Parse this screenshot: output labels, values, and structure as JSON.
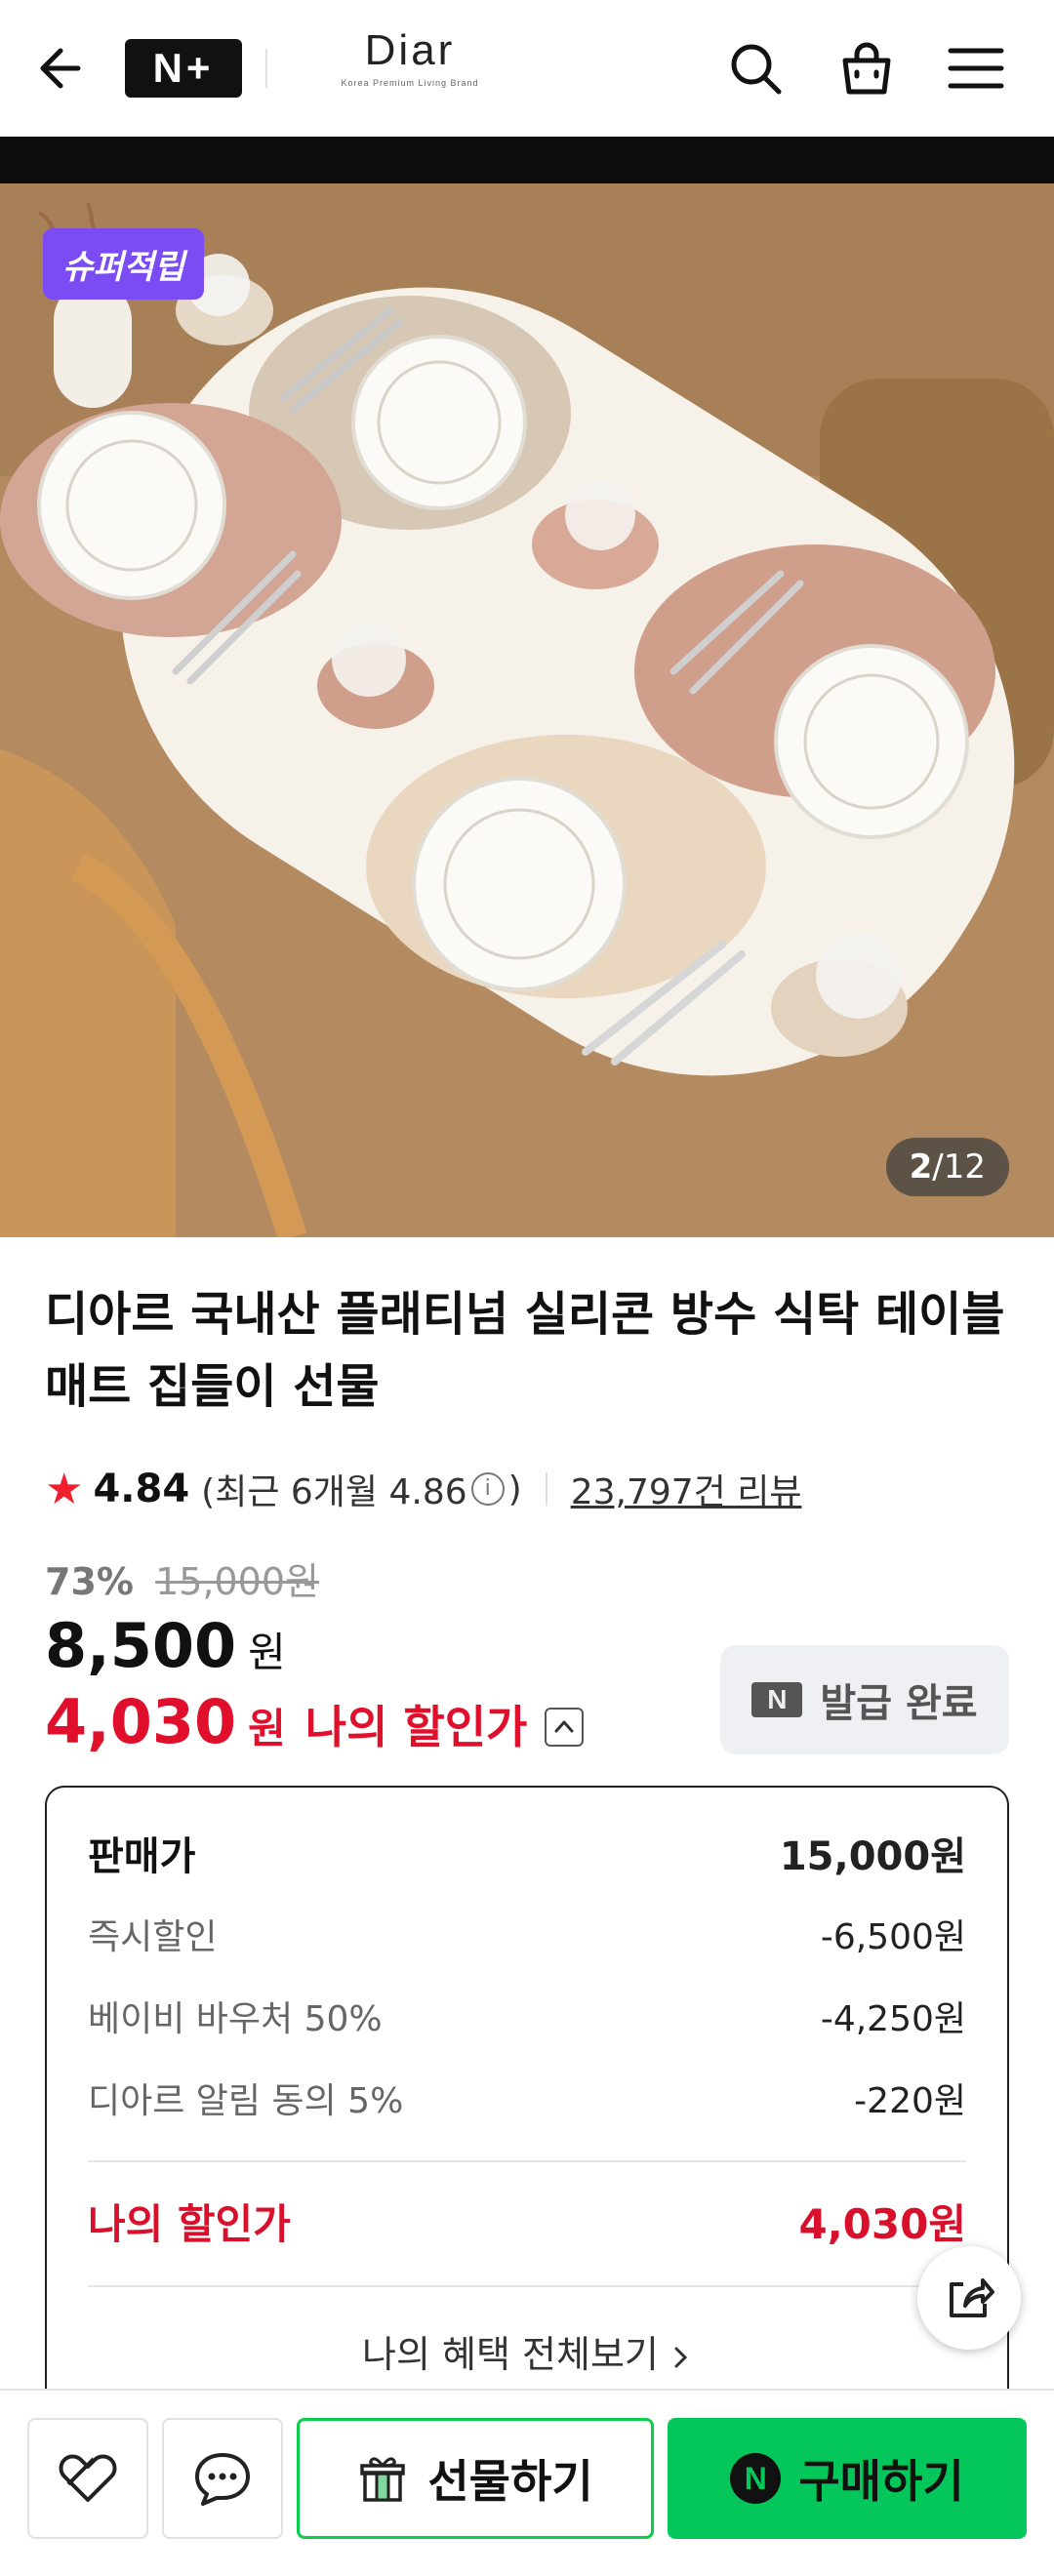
{
  "header": {
    "nplus_label": "N+",
    "brand_name": "Diar",
    "brand_tagline": "Korea Premium Living Brand"
  },
  "product_image": {
    "badge": "슈퍼적립",
    "counter_current": "2",
    "counter_sep": "/",
    "counter_total": "12"
  },
  "product": {
    "title": "디아르 국내산 플래티넘 실리콘 방수 식탁 테이블 매트 집들이 선물",
    "rating": "4.84",
    "recent_rating_text": "(최근 6개월 4.86",
    "recent_rating_close": ")",
    "info_icon": "i",
    "review_count": "23,797건 리뷰",
    "discount_pct": "73%",
    "original_price": "15,000원",
    "price": "8,500",
    "price_unit": "원",
    "my_price": "4,030",
    "my_price_unit": "원",
    "my_price_label": "나의 할인가",
    "coupon_logo": "N",
    "coupon_label": "발급 완료"
  },
  "breakdown": {
    "sale_label": "판매가",
    "sale_value": "15,000원",
    "rows": [
      {
        "label": "즉시할인",
        "value": "-6,500원"
      },
      {
        "label": "베이비 바우처 50%",
        "value": "-4,250원"
      },
      {
        "label": "디아르 알림 동의 5%",
        "value": "-220원"
      }
    ],
    "my_label": "나의 할인가",
    "my_value": "4,030원",
    "all_benefits": "나의 혜택 전체보기"
  },
  "bottom": {
    "gift_label": "선물하기",
    "buy_logo": "N",
    "buy_label": "구매하기"
  },
  "colors": {
    "badge": "#7b4cf4",
    "discount_red": "#e0102d",
    "naver_green": "#03c75a",
    "star": "#f0202d"
  }
}
